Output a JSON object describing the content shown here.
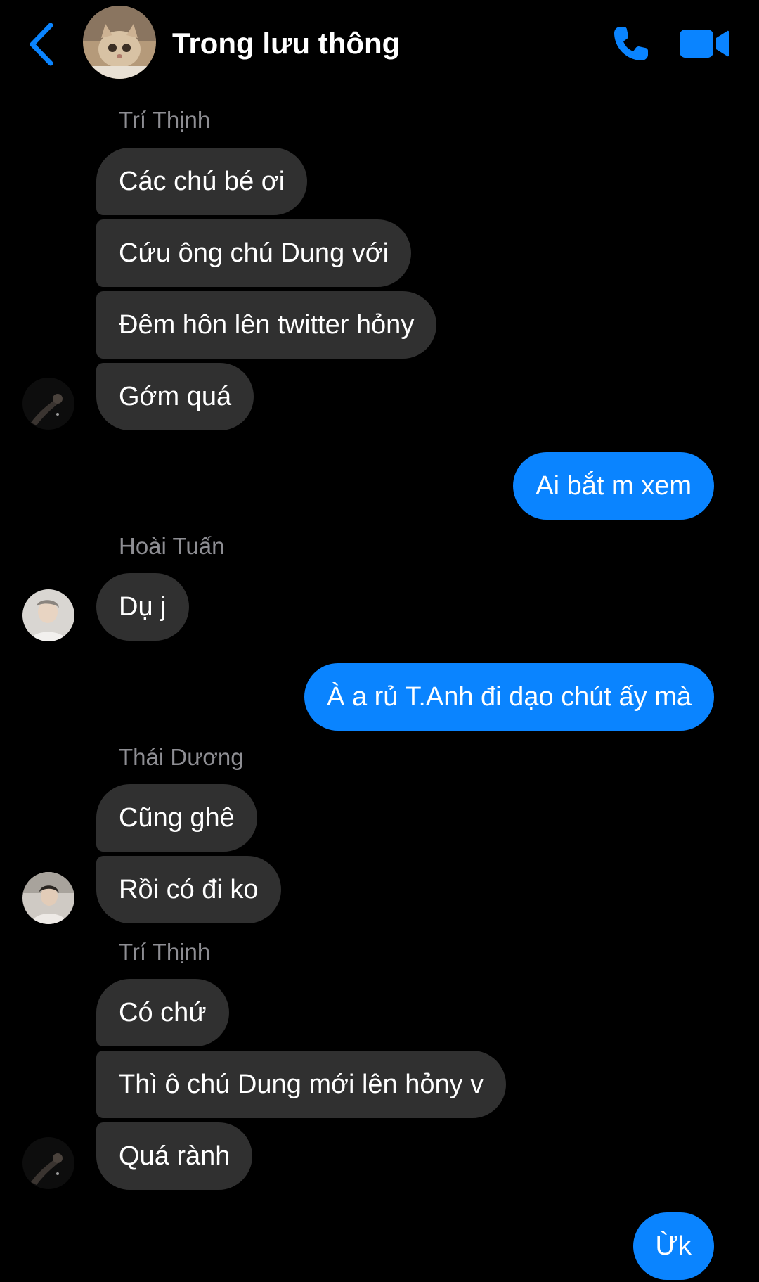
{
  "header": {
    "title": "Trong lưu thông",
    "back_icon": "chevron-left-icon",
    "call_icon": "phone-icon",
    "video_icon": "video-camera-icon",
    "accent_color": "#0a84ff"
  },
  "messages": {
    "g1": {
      "sender": "Trí Thịnh",
      "m1": "Các chú bé ơi",
      "m2": "Cứu ông chú Dung với",
      "m3": "Đêm hôn lên twitter hỏny",
      "m4": "Gớm quá"
    },
    "o1": "Ai bắt m xem",
    "g2": {
      "sender": "Hoài Tuấn",
      "m1": "Dụ j"
    },
    "o2": "À a rủ T.Anh đi dạo chút ấy mà",
    "g3": {
      "sender": "Thái Dương",
      "m1": "Cũng ghê",
      "m2": "Rồi có đi ko"
    },
    "g4": {
      "sender": "Trí Thịnh",
      "m1": "Có chứ",
      "m2": "Thì ô chú Dung mới lên hỏny v",
      "m3": "Quá rành"
    },
    "o3": "Ừk"
  },
  "colors": {
    "incoming_bubble": "#303030",
    "outgoing_bubble": "#0a84ff",
    "sender_name": "#8e8e93",
    "background": "#000000"
  }
}
